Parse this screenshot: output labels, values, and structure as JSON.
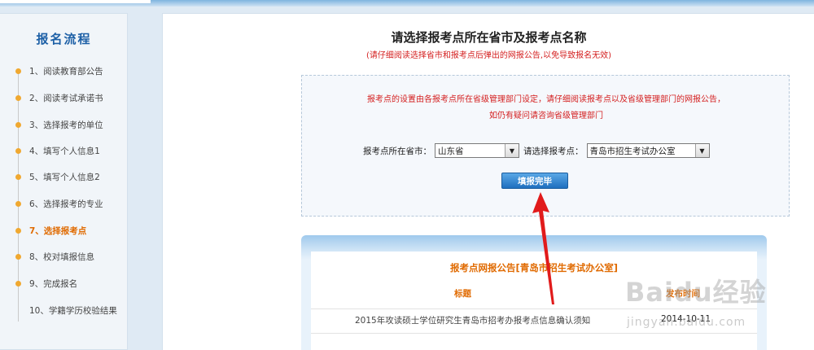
{
  "sidebar": {
    "title": "报名流程",
    "steps": [
      {
        "label": "1、阅读教育部公告"
      },
      {
        "label": "2、阅读考试承诺书"
      },
      {
        "label": "3、选择报考的单位"
      },
      {
        "label": "4、填写个人信息1"
      },
      {
        "label": "5、填写个人信息2"
      },
      {
        "label": "6、选择报考的专业"
      },
      {
        "label": "7、选择报考点"
      },
      {
        "label": "8、校对填报信息"
      },
      {
        "label": "9、完成报名"
      },
      {
        "label": "10、学籍学历校验结果"
      }
    ],
    "active_index": 6
  },
  "main": {
    "title": "请选择报考点所在省市及报考点名称",
    "subtitle": "(请仔细阅读选择省市和报考点后弹出的网报公告,以免导致报名无效)",
    "notice_line1": "报考点的设置由各报考点所在省级管理部门设定，请仔细阅读报考点以及省级管理部门的网报公告，",
    "notice_line2": "如仍有疑问请咨询省级管理部门",
    "province_label": "报考点所在省市：",
    "province_value": "山东省",
    "site_label": "请选择报考点：",
    "site_value": "青岛市招生考试办公室",
    "submit_label": "填报完毕"
  },
  "announcement": {
    "title": "报考点网报公告[青岛市招生考试办公室]",
    "col_title": "标题",
    "col_date": "发布时间",
    "rows": [
      {
        "title": "2015年攻读硕士学位研究生青岛市招考办报考点信息确认须知",
        "date": "2014-10-11"
      }
    ]
  },
  "watermark": {
    "text": "Baidu经验",
    "sub": "jingyan.baidu.com"
  },
  "colors": {
    "accent_blue": "#1c5fa6",
    "warning_red": "#d41f1f",
    "highlight_orange": "#e06a00",
    "arrow_red": "#e11b1b"
  }
}
